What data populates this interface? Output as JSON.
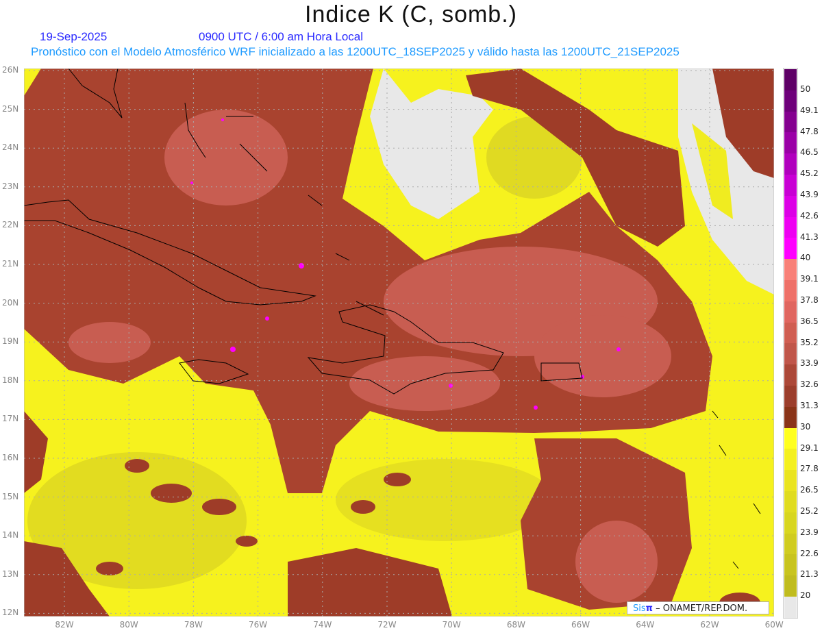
{
  "header": {
    "title": "Indice K (C, somb.)",
    "date": "19-Sep-2025",
    "time": "0900 UTC / 6:00 am Hora Local",
    "info": "Pronóstico con el Modelo Atmosférico WRF inicializado a las 1200UTC_18SEP2025 y válido hasta las  1200UTC_21SEP2025"
  },
  "axes": {
    "lat_labels": [
      "26N",
      "25N",
      "24N",
      "23N",
      "22N",
      "21N",
      "20N",
      "19N",
      "18N",
      "17N",
      "16N",
      "15N",
      "14N",
      "13N",
      "12N"
    ],
    "lon_labels": [
      "82W",
      "80W",
      "78W",
      "76W",
      "74W",
      "72W",
      "70W",
      "68W",
      "66W",
      "64W",
      "62W",
      "60W"
    ]
  },
  "colorbar": {
    "labels": [
      "50",
      "49.1",
      "47.8",
      "46.5",
      "45.2",
      "43.9",
      "42.6",
      "41.3",
      "40",
      "39.1",
      "37.8",
      "36.5",
      "35.2",
      "33.9",
      "32.6",
      "31.3",
      "30",
      "29.1",
      "27.8",
      "26.5",
      "25.2",
      "23.9",
      "22.6",
      "21.3",
      "20"
    ],
    "colors": [
      "#5e0066",
      "#6e007a",
      "#84008f",
      "#9a00a6",
      "#b000bd",
      "#c800d4",
      "#dc00e6",
      "#ee00f2",
      "#ff00ff",
      "#f88078",
      "#ee7068",
      "#e06660",
      "#d05e52",
      "#c0564a",
      "#ac4838",
      "#9c3e2c",
      "#8a3418",
      "#ffff1e",
      "#f4f01e",
      "#eae420",
      "#e0dc20",
      "#d8d620",
      "#d0cc20",
      "#c8c41e",
      "#c0bc1e",
      "#e8e8e8"
    ]
  },
  "credit": {
    "brand_a": "Sis",
    "brand_b": "π",
    "text": " – ONAMET/REP.DOM."
  }
}
